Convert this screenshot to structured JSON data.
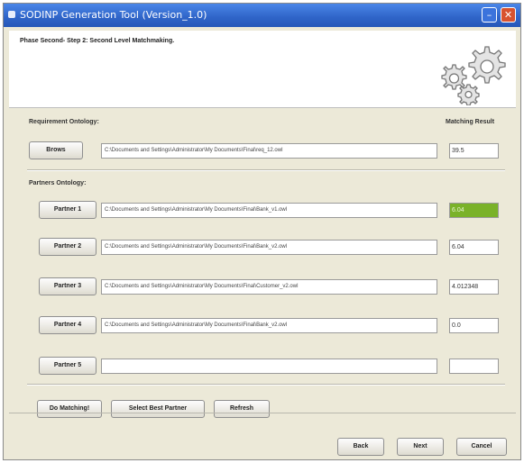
{
  "window": {
    "title": "SODINP Generation Tool (Version_1.0)"
  },
  "header": {
    "phase_label": "Phase Second- Step 2: Second Level Matchmaking."
  },
  "requirement": {
    "section_label": "Requirement Ontology:",
    "matching_result_label": "Matching Result",
    "browse_label": "Brows",
    "path": "C:\\Documents and Settings\\Administrator\\My Documents\\Final\\req_12.owl",
    "result": "39.5"
  },
  "partners": {
    "section_label": "Partners Ontology:",
    "items": [
      {
        "label": "Partner 1",
        "path": "C:\\Documents and Settings\\Administrator\\My Documents\\Final\\Bank_v1.owl",
        "result": "6.04"
      },
      {
        "label": "Partner 2",
        "path": "C:\\Documents and Settings\\Administrator\\My Documents\\Final\\Bank_v2.owl",
        "result": "6.04"
      },
      {
        "label": "Partner 3",
        "path": "C:\\Documents and Settings\\Administrator\\My Documents\\Final\\Customer_v2.owl",
        "result": "4.012348"
      },
      {
        "label": "Partner 4",
        "path": "C:\\Documents and Settings\\Administrator\\My Documents\\Final\\Bank_v2.owl",
        "result": "0.0"
      },
      {
        "label": "Partner 5",
        "path": "",
        "result": ""
      }
    ]
  },
  "actions": {
    "do_matching": "Do Matching!",
    "select_best": "Select Best Partner",
    "refresh": "Refresh"
  },
  "footer": {
    "back": "Back",
    "next": "Next",
    "cancel": "Cancel"
  },
  "colors": {
    "best_match": "#7ab229",
    "titlebar": "#2f64c8"
  },
  "icons": [
    "gears-icon",
    "minimize-icon",
    "close-icon"
  ]
}
